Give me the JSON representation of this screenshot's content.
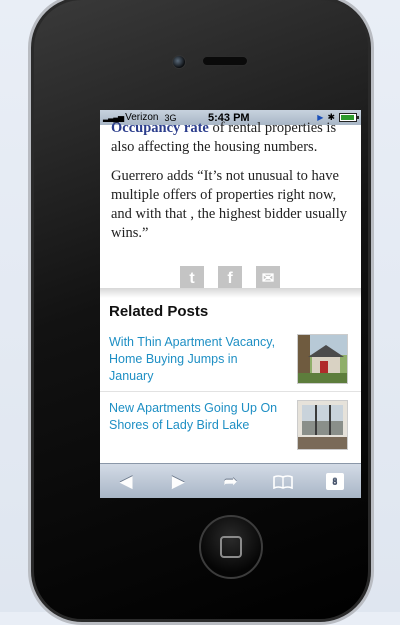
{
  "status_bar": {
    "signal": "▂▃▄▅",
    "carrier": "Verizon",
    "network": "3G",
    "time": "5:43 PM",
    "location_icon": "▶",
    "bluetooth_icon": "✱"
  },
  "article": {
    "p1_link": "Occupancy rate",
    "p1_rest": " of rental properties is also affecting the housing numbers.",
    "p2": "Guerrero adds “It’s not unusual to have multiple offers of properties right now, and with that , the highest bidder usually wins.”"
  },
  "share": {
    "twitter": "t",
    "facebook": "f",
    "email": "✉"
  },
  "related": {
    "heading": "Related Posts",
    "posts": [
      {
        "title": "With Thin Apartment Vacancy, Home Buying Jumps in January"
      },
      {
        "title": "New Apartments Going Up On Shores of Lady Bird Lake"
      }
    ]
  },
  "toolbar": {
    "back": "◀",
    "forward": "▶",
    "share": "➦",
    "bookmarks": "📖",
    "pages_count": "8"
  }
}
